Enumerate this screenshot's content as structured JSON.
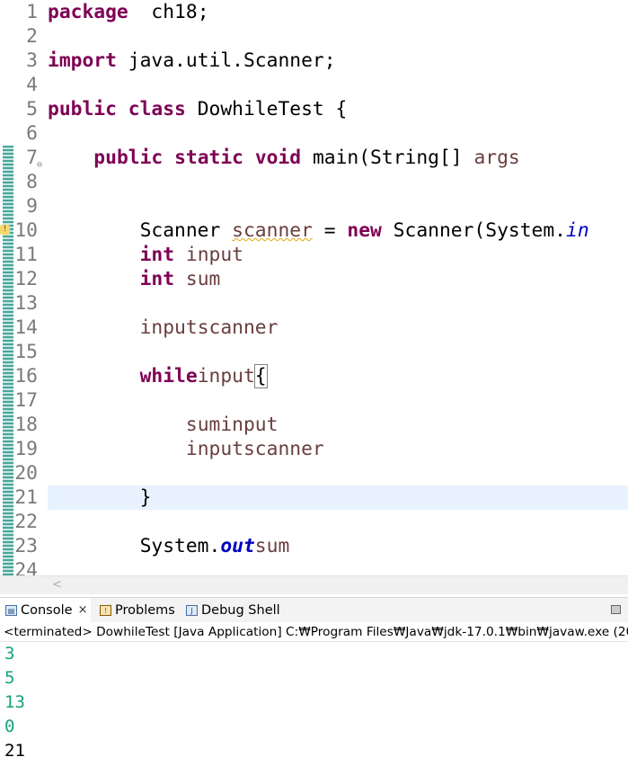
{
  "editor": {
    "lines": [
      {
        "num": "1",
        "parts": [
          [
            "kw",
            "package"
          ],
          [
            "",
            "  ch18;"
          ]
        ]
      },
      {
        "num": "2",
        "parts": []
      },
      {
        "num": "3",
        "parts": [
          [
            "kw",
            "import"
          ],
          [
            "",
            " java.util.Scanner;"
          ]
        ]
      },
      {
        "num": "4",
        "parts": []
      },
      {
        "num": "5",
        "parts": [
          [
            "kw",
            "public"
          ],
          [
            "",
            " "
          ],
          [
            "kw",
            "class"
          ],
          [
            "",
            " DowhileTest {"
          ]
        ]
      },
      {
        "num": "6",
        "parts": []
      },
      {
        "num": "7",
        "parts": [
          [
            "",
            "    "
          ],
          [
            "kw",
            "public"
          ],
          [
            "",
            " "
          ],
          [
            "kw",
            "static"
          ],
          [
            "",
            " "
          ],
          [
            "kw",
            "void"
          ],
          [
            "",
            " main(String[] "
          ],
          [
            "var",
            "args"
          ],
          [
            ") {"
          ]
        ]
      },
      {
        "num": "8",
        "parts": []
      },
      {
        "num": "9",
        "parts": []
      },
      {
        "num": "10",
        "parts": [
          [
            "",
            "        Scanner "
          ],
          [
            "var warn",
            "scanner"
          ],
          [
            "",
            " = "
          ],
          [
            "kw",
            "new"
          ],
          [
            "",
            " Scanner(System."
          ],
          [
            "fld2",
            "in"
          ],
          [
            ");"
          ]
        ]
      },
      {
        "num": "11",
        "parts": [
          [
            "",
            "        "
          ],
          [
            "kw",
            "int"
          ],
          [
            "",
            " "
          ],
          [
            "var",
            "input"
          ],
          [
            ";"
          ]
        ]
      },
      {
        "num": "12",
        "parts": [
          [
            "",
            "        "
          ],
          [
            "kw",
            "int"
          ],
          [
            "",
            " "
          ],
          [
            "var",
            "sum"
          ],
          [
            " = 0;"
          ]
        ]
      },
      {
        "num": "13",
        "parts": []
      },
      {
        "num": "14",
        "parts": [
          [
            "",
            "        "
          ],
          [
            "var",
            "input"
          ],
          [
            " = "
          ],
          [
            "var",
            "scanner"
          ],
          [
            ".nextInt();"
          ]
        ]
      },
      {
        "num": "15",
        "parts": []
      },
      {
        "num": "16",
        "parts": [
          [
            "",
            "        "
          ],
          [
            "kw",
            "while"
          ],
          [
            "( "
          ],
          [
            "var",
            "input"
          ],
          [
            " != 0) "
          ],
          [
            "brk",
            "{"
          ]
        ]
      },
      {
        "num": "17",
        "parts": []
      },
      {
        "num": "18",
        "parts": [
          [
            "",
            "            "
          ],
          [
            "var",
            "sum"
          ],
          [
            " += "
          ],
          [
            "var",
            "input"
          ],
          [
            ";"
          ]
        ]
      },
      {
        "num": "19",
        "parts": [
          [
            "",
            "            "
          ],
          [
            "var",
            "input"
          ],
          [
            " = "
          ],
          [
            "var",
            "scanner"
          ],
          [
            ".nextInt();"
          ]
        ]
      },
      {
        "num": "20",
        "parts": []
      },
      {
        "num": "21",
        "parts": [
          [
            "",
            "        }"
          ]
        ],
        "current": true
      },
      {
        "num": "22",
        "parts": []
      },
      {
        "num": "23",
        "parts": [
          [
            "",
            "        System."
          ],
          [
            "fld",
            "out"
          ],
          [
            ".println("
          ],
          [
            "var",
            "sum"
          ],
          [
            ");"
          ]
        ]
      },
      {
        "num": "24",
        "parts": []
      }
    ],
    "fold_marker": "⊖",
    "warning_marker": "!",
    "scroll_left_arrow": "<"
  },
  "console": {
    "tabs": [
      {
        "label": "Console",
        "icon": "console-icon",
        "close": "×"
      },
      {
        "label": "Problems",
        "icon": "problems-icon"
      },
      {
        "label": "Debug Shell",
        "icon": "debug-shell-icon"
      }
    ],
    "status": "<terminated> DowhileTest [Java Application] C:₩Program Files₩Java₩jdk-17.0.1₩bin₩javaw.exe  (2021",
    "output": [
      {
        "text": "3",
        "kind": "input"
      },
      {
        "text": "5",
        "kind": "input"
      },
      {
        "text": "13",
        "kind": "input"
      },
      {
        "text": "0",
        "kind": "input"
      },
      {
        "text": "21",
        "kind": "stdout"
      }
    ]
  }
}
